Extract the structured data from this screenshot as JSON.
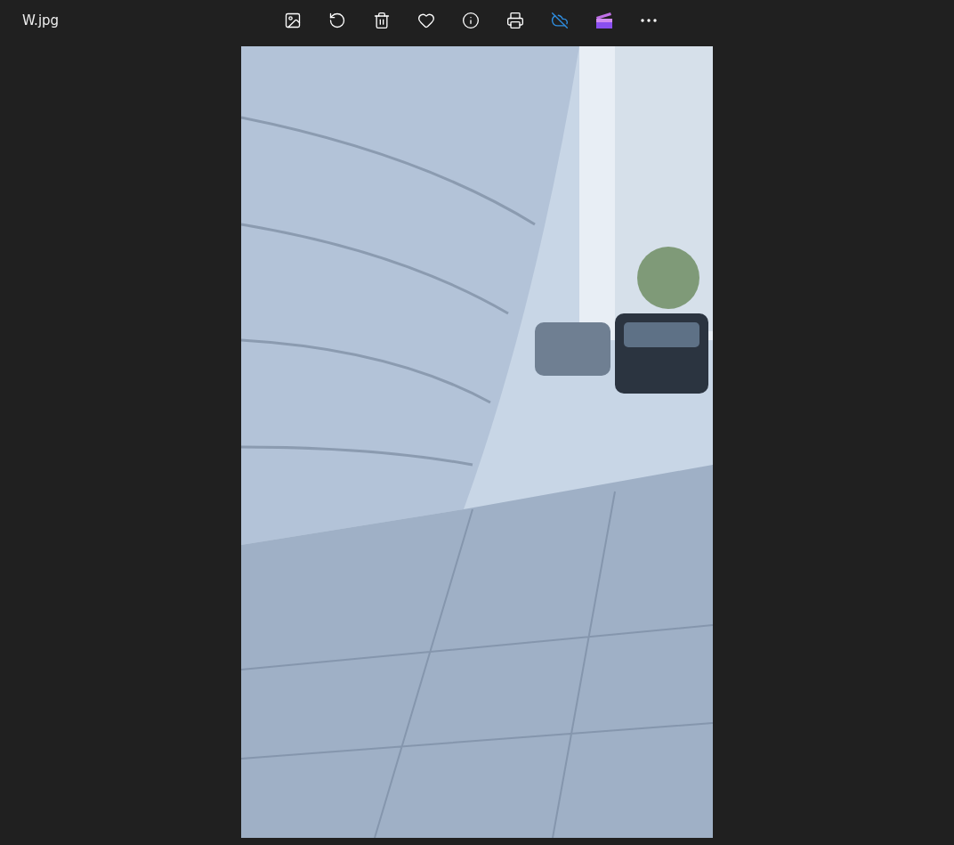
{
  "window": {
    "title": "W.jpg"
  },
  "toolbar": [
    {
      "kind": "edit"
    },
    {
      "kind": "rotate"
    },
    {
      "kind": "delete"
    },
    {
      "kind": "favorite"
    },
    {
      "kind": "info"
    },
    {
      "kind": "print"
    },
    {
      "kind": "cloud"
    },
    {
      "kind": "video"
    },
    {
      "kind": "more"
    }
  ]
}
